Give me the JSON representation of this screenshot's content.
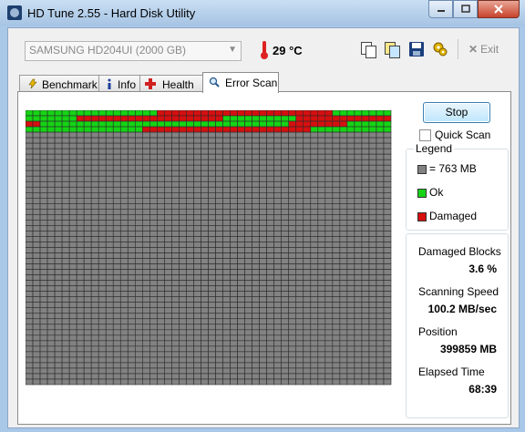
{
  "window": {
    "title": "HD Tune 2.55 - Hard Disk Utility"
  },
  "toolbar": {
    "drive": "SAMSUNG HD204UI (2000 GB)",
    "temperature": "29 °C",
    "exit_label": "Exit",
    "exit_glyph": "✕",
    "icons": [
      "copy-info-icon",
      "copy-screenshot-icon",
      "save-icon",
      "options-icon"
    ]
  },
  "tabs": [
    {
      "label": "Benchmark",
      "icon": "benchmark-icon"
    },
    {
      "label": "Info",
      "icon": "info-icon"
    },
    {
      "label": "Health",
      "icon": "health-icon"
    },
    {
      "label": "Error Scan",
      "icon": "search-icon",
      "active": true
    }
  ],
  "scan": {
    "stop_label": "Stop",
    "quick_scan_label": "Quick Scan",
    "quick_scan_checked": false,
    "grid_columns": 50,
    "grid_rows": 50,
    "scanned_blocks": 200,
    "damaged_ranges": [
      [
        18,
        41
      ],
      [
        57,
        76
      ],
      [
        87,
        101
      ],
      [
        136,
        143
      ],
      [
        166,
        188
      ]
    ],
    "colors": {
      "ok": "#15d415",
      "damaged": "#d60f0f",
      "unscanned": "#828282",
      "grid_line": "#2a2a2a"
    }
  },
  "legend": {
    "title": "Legend",
    "block": "= 763 MB",
    "ok": "Ok",
    "damaged": "Damaged"
  },
  "stats": {
    "damaged_blocks_label": "Damaged Blocks",
    "damaged_blocks_value": "3.6 %",
    "scanning_speed_label": "Scanning Speed",
    "scanning_speed_value": "100.2 MB/sec",
    "position_label": "Position",
    "position_value": "399859 MB",
    "elapsed_label": "Elapsed Time",
    "elapsed_value": "68:39"
  }
}
